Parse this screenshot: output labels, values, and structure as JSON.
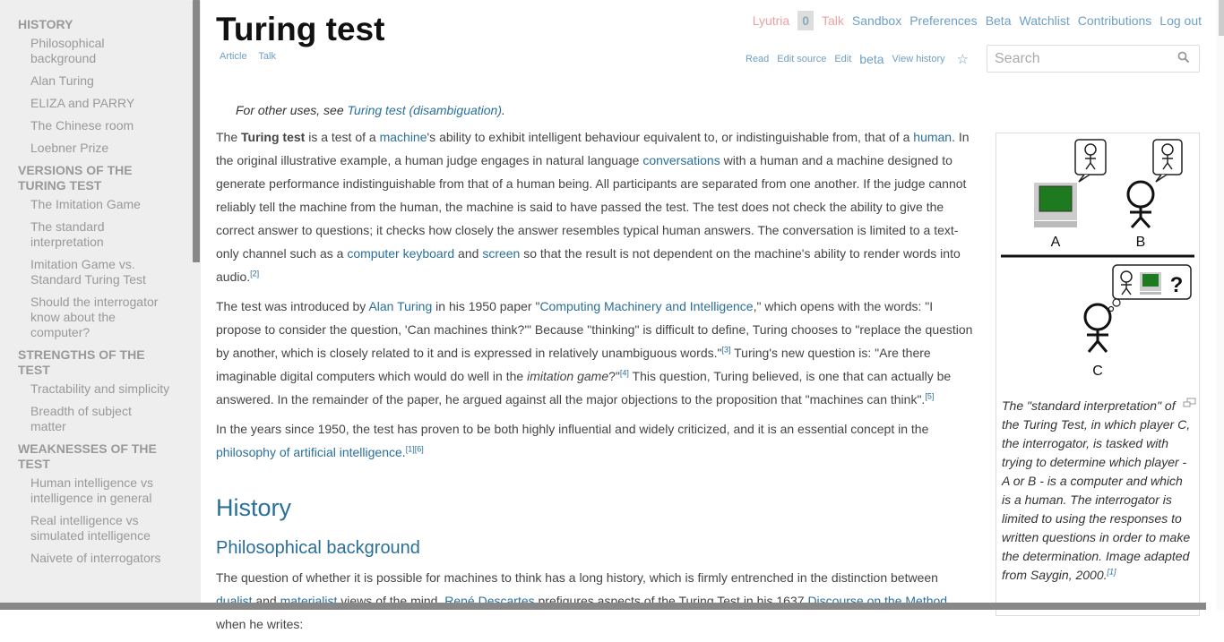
{
  "toc": [
    {
      "type": "item",
      "label": "Philosophical background"
    },
    {
      "type": "item",
      "label": "Alan Turing"
    },
    {
      "type": "item",
      "label": "ELIZA and PARRY"
    },
    {
      "type": "item",
      "label": "The Chinese room"
    },
    {
      "type": "item",
      "label": "Loebner Prize"
    },
    {
      "type": "section",
      "label": "Versions of the Turing test"
    },
    {
      "type": "item",
      "label": "The Imitation Game"
    },
    {
      "type": "item",
      "label": "The standard interpretation"
    },
    {
      "type": "item",
      "label": "Imitation Game vs. Standard Turing Test"
    },
    {
      "type": "item",
      "label": "Should the interrogator know about the computer?"
    },
    {
      "type": "section",
      "label": "Strengths of the test"
    },
    {
      "type": "item",
      "label": "Tractability and simplicity"
    },
    {
      "type": "item",
      "label": "Breadth of subject matter"
    },
    {
      "type": "section",
      "label": "Weaknesses of the test"
    },
    {
      "type": "item",
      "label": "Human intelligence vs intelligence in general"
    },
    {
      "type": "item",
      "label": "Real intelligence vs simulated intelligence"
    },
    {
      "type": "item",
      "label": "Naivete of interrogators"
    }
  ],
  "toc_top": "History",
  "title": "Turing test",
  "ns_tabs": {
    "article": "Article",
    "talk": "Talk"
  },
  "usermenu": {
    "user": "Lyutria",
    "notifications": "0",
    "talk": "Talk",
    "sandbox": "Sandbox",
    "preferences": "Preferences",
    "beta": "Beta",
    "watchlist": "Watchlist",
    "contributions": "Contributions",
    "logout": "Log out"
  },
  "views": {
    "read": "Read",
    "edit_source": "Edit source",
    "edit": "Edit",
    "beta": "beta",
    "history": "View history"
  },
  "search": {
    "placeholder": "Search"
  },
  "hatnote": {
    "prefix": "For other uses, see ",
    "link": "Turing test (disambiguation)",
    "suffix": "."
  },
  "p1": {
    "t1": "The ",
    "bold": "Turing test",
    "t2": " is a test of a ",
    "l1": "machine",
    "t3": "'s ability to exhibit intelligent behaviour equivalent to, or indistinguishable from, that of a ",
    "l2": "human",
    "t4": ". In the original illustrative example, a human judge engages in natural language ",
    "l3": "conversations",
    "t5": " with a human and a machine designed to generate performance indistinguishable from that of a human being. All participants are separated from one another. If the judge cannot reliably tell the machine from the human, the machine is said to have passed the test. The test does not check the ability to give the correct answer to questions; it checks how closely the answer resembles typical human answers. The conversation is limited to a text-only channel such as a ",
    "l4": "computer keyboard",
    "t6": " and ",
    "l5": "screen",
    "t7": " so that the result is not dependent on the machine's ability to render words into audio.",
    "ref": "[2]"
  },
  "p2": {
    "t1": "The test was introduced by ",
    "l1": "Alan Turing",
    "t2": " in his 1950 paper \"",
    "l2": "Computing Machinery and Intelligence",
    "t3": ",\" which opens with the words: \"I propose to consider the question, 'Can machines think?'\" Because \"thinking\" is difficult to define, Turing chooses to \"replace the question by another, which is closely related to it and is expressed in relatively unambiguous words.\"",
    "ref1": "[3]",
    "t4": " Turing's new question is: \"Are there imaginable digital computers which would do well in the ",
    "em": "imitation game",
    "t5": "?\"",
    "ref2": "[4]",
    "t6": " This question, Turing believed, is one that can actually be answered. In the remainder of the paper, he argued against all the major objections to the proposition that \"machines can think\".",
    "ref3": "[5]"
  },
  "p3": {
    "t1": "In the years since 1950, the test has proven to be both highly influential and widely criticized, and it is an essential concept in the ",
    "l1": "philosophy of artificial intelligence",
    "t2": ".",
    "ref": "[1][6]"
  },
  "h2": "History",
  "h3": "Philosophical background",
  "p4": {
    "t1": "The question of whether it is possible for machines to think has a long history, which is firmly entrenched in the distinction between ",
    "l1": "dualist",
    "t2": " and ",
    "l2": "materialist",
    "t3": " views of the mind. ",
    "l3": "René Descartes",
    "t4": " prefigures aspects of the Turing Test in his 1637 ",
    "l4": "Discourse on the Method",
    "t5": " when he writes:"
  },
  "figure": {
    "label_a": "A",
    "label_b": "B",
    "label_c": "C",
    "question_mark": "?"
  },
  "caption": {
    "text": "The \"standard interpretation\" of the Turing Test, in which player C, the interrogator, is tasked with trying to determine which player - A or B - is a computer and which is a human. The interrogator is limited to using the responses to written questions in order to make the determination. Image adapted from Saygin, 2000.",
    "ref": "[1]"
  }
}
